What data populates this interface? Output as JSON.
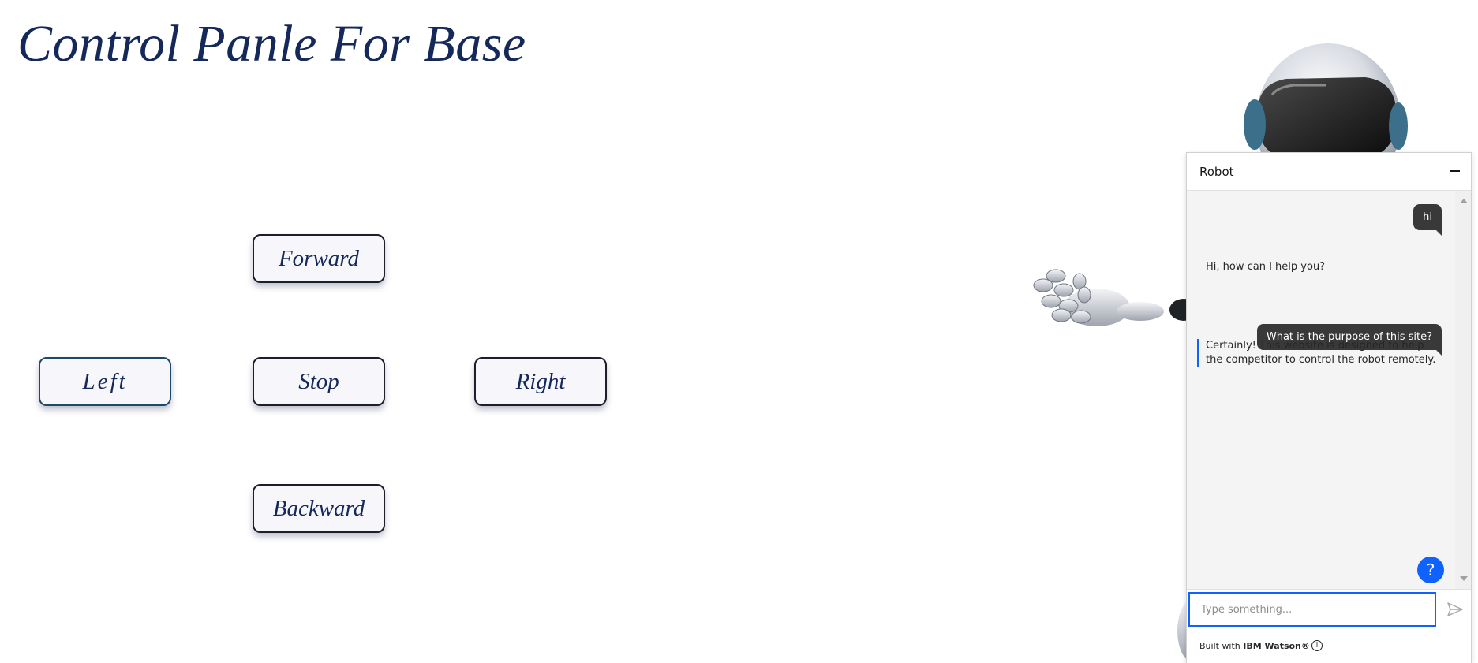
{
  "page": {
    "title": "Control Panle For Base"
  },
  "controls": {
    "forward": "Forward",
    "left": "Left",
    "stop": "Stop",
    "right": "Right",
    "backward": "Backward"
  },
  "chat": {
    "title": "Robot",
    "messages": [
      {
        "from": "user",
        "text": "hi"
      },
      {
        "from": "bot",
        "text": "Hi, how can I help you?"
      },
      {
        "from": "user",
        "text": "What is the purpose of this site?"
      },
      {
        "from": "bot",
        "text": "Certainly! This website is designed to help the competitor to control the robot remotely."
      }
    ],
    "input_placeholder": "Type something...",
    "help_label": "?",
    "footer_prefix": "Built with ",
    "footer_brand": "IBM Watson®",
    "info_label": "i"
  },
  "colors": {
    "title": "#14285a",
    "accent": "#0f62fe",
    "user_bubble": "#393939"
  }
}
